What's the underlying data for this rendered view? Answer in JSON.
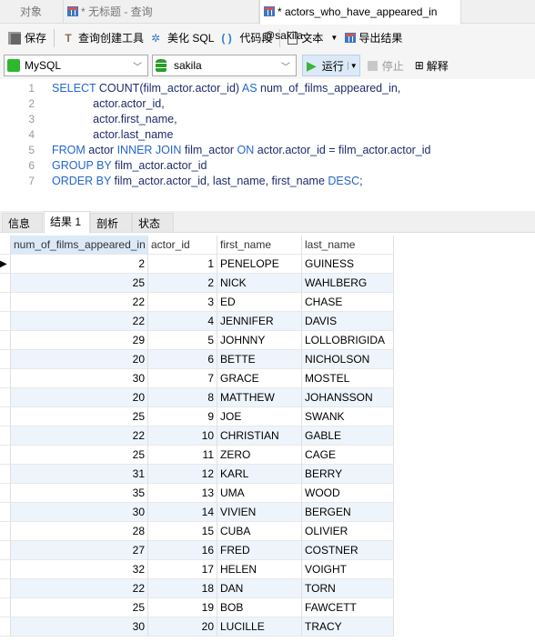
{
  "tabs": [
    {
      "label": "对象"
    },
    {
      "label": "* 无标题 - 查询"
    },
    {
      "label": "* actors_who_have_appeared_in @sakila ..."
    }
  ],
  "toolbar": {
    "save": "保存",
    "query_builder": "查询创建工具",
    "beautify": "美化 SQL",
    "snippet": "代码段",
    "text": "文本",
    "export": "导出结果"
  },
  "connection": {
    "type": "MySQL",
    "database": "sakila",
    "run": "运行",
    "stop": "停止",
    "explain": "解释"
  },
  "editor": {
    "lines": [
      [
        [
          "kw",
          "SELECT "
        ],
        [
          "",
          "COUNT(film_actor.actor_id) "
        ],
        [
          "kw",
          "AS"
        ],
        [
          "",
          " num_of_films_appeared_in,"
        ]
      ],
      [
        [
          "",
          "             actor.actor_id,"
        ]
      ],
      [
        [
          "",
          "             actor.first_name,"
        ]
      ],
      [
        [
          "",
          "             actor.last_name"
        ]
      ],
      [
        [
          "kw",
          "FROM"
        ],
        [
          "",
          " actor "
        ],
        [
          "kw",
          "INNER JOIN"
        ],
        [
          "",
          " film_actor "
        ],
        [
          "kw",
          "ON"
        ],
        [
          "",
          " actor.actor_id = film_actor.actor_id"
        ]
      ],
      [
        [
          "kw",
          "GROUP BY"
        ],
        [
          "",
          " film_actor.actor_id"
        ]
      ],
      [
        [
          "kw",
          "ORDER BY"
        ],
        [
          "",
          " film_actor.actor_id, last_name, first_name "
        ],
        [
          "kw",
          "DESC"
        ],
        [
          "",
          ";"
        ]
      ]
    ],
    "line_numbers": [
      "1",
      "2",
      "3",
      "4",
      "5",
      "6",
      "7"
    ]
  },
  "result_tabs": [
    {
      "label": "信息"
    },
    {
      "label": "结果 1"
    },
    {
      "label": "剖析"
    },
    {
      "label": "状态"
    }
  ],
  "grid": {
    "columns": [
      "num_of_films_appeared_in",
      "actor_id",
      "first_name",
      "last_name"
    ],
    "rows": [
      [
        "2",
        "1",
        "PENELOPE",
        "GUINESS"
      ],
      [
        "25",
        "2",
        "NICK",
        "WAHLBERG"
      ],
      [
        "22",
        "3",
        "ED",
        "CHASE"
      ],
      [
        "22",
        "4",
        "JENNIFER",
        "DAVIS"
      ],
      [
        "29",
        "5",
        "JOHNNY",
        "LOLLOBRIGIDA"
      ],
      [
        "20",
        "6",
        "BETTE",
        "NICHOLSON"
      ],
      [
        "30",
        "7",
        "GRACE",
        "MOSTEL"
      ],
      [
        "20",
        "8",
        "MATTHEW",
        "JOHANSSON"
      ],
      [
        "25",
        "9",
        "JOE",
        "SWANK"
      ],
      [
        "22",
        "10",
        "CHRISTIAN",
        "GABLE"
      ],
      [
        "25",
        "11",
        "ZERO",
        "CAGE"
      ],
      [
        "31",
        "12",
        "KARL",
        "BERRY"
      ],
      [
        "35",
        "13",
        "UMA",
        "WOOD"
      ],
      [
        "30",
        "14",
        "VIVIEN",
        "BERGEN"
      ],
      [
        "28",
        "15",
        "CUBA",
        "OLIVIER"
      ],
      [
        "27",
        "16",
        "FRED",
        "COSTNER"
      ],
      [
        "32",
        "17",
        "HELEN",
        "VOIGHT"
      ],
      [
        "22",
        "18",
        "DAN",
        "TORN"
      ],
      [
        "25",
        "19",
        "BOB",
        "FAWCETT"
      ],
      [
        "30",
        "20",
        "LUCILLE",
        "TRACY"
      ]
    ]
  }
}
